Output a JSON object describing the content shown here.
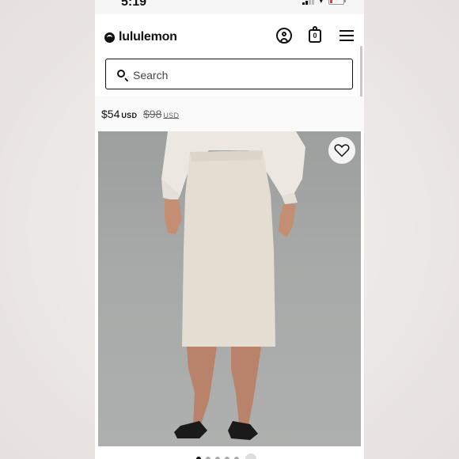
{
  "status_bar": {
    "time": "5:19",
    "battery_level_percent": 10
  },
  "header": {
    "logo_text": "lululemon",
    "icons": [
      "account-icon",
      "shopping-bag-icon",
      "menu-icon"
    ],
    "bag_count": "0"
  },
  "search": {
    "placeholder": "Search",
    "value": ""
  },
  "product": {
    "sale_price": "$54",
    "sale_currency": "USD",
    "original_price": "$98",
    "original_currency": "USD",
    "image_alt_icon": "heart-icon"
  },
  "carousel": {
    "slide_count": 6,
    "active_index": 0
  },
  "colors": {
    "brand": "#111111",
    "background": "#ffffff",
    "photo_bg": "#a7a9a8",
    "battery_low": "#e23b3b"
  }
}
